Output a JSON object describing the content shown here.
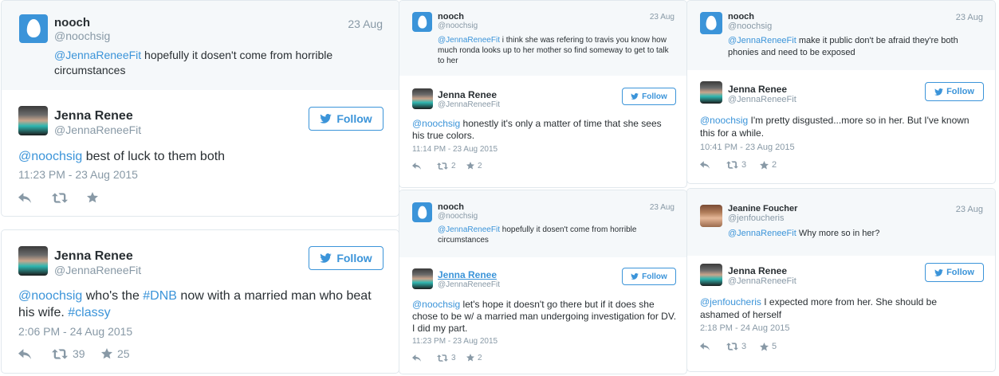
{
  "tweets": [
    {
      "ctx": {
        "name": "nooch",
        "handle": "@noochsig",
        "date": "23 Aug",
        "mention": "@JennaReneeFit",
        "text": " hopefully it dosen't come from horrible circumstances"
      },
      "reply": {
        "name": "Jenna Renee",
        "handle": "@JennaReneeFit",
        "follow": "Follow",
        "mention": "@noochsig",
        "text": " best of luck to them both",
        "time": "11:23 PM - 23 Aug 2015",
        "retweets": "",
        "likes": ""
      }
    },
    {
      "reply": {
        "name": "Jenna Renee",
        "handle": "@JennaReneeFit",
        "follow": "Follow",
        "mention": "@noochsig",
        "text_a": " who's the ",
        "hashtag1": "#DNB",
        "text_b": " now with a married man who beat his wife.  ",
        "hashtag2": "#classy",
        "time": "2:06 PM - 24 Aug 2015",
        "retweets": "39",
        "likes": "25"
      }
    },
    {
      "ctx": {
        "name": "nooch",
        "handle": "@noochsig",
        "date": "23 Aug",
        "mention": "@JennaReneeFit",
        "text": " i think she was refering to travis you know how much ronda looks up to her mother so find someway to get to talk to her"
      },
      "reply": {
        "name": "Jenna Renee",
        "handle": "@JennaReneeFit",
        "follow": "Follow",
        "mention": "@noochsig",
        "text": " honestly it's only a matter of time that she sees his true colors.",
        "time": "11:14 PM - 23 Aug 2015",
        "retweets": "2",
        "likes": "2"
      }
    },
    {
      "ctx": {
        "name": "nooch",
        "handle": "@noochsig",
        "date": "23 Aug",
        "mention": "@JennaReneeFit",
        "text": " hopefully it dosen't come from horrible circumstances"
      },
      "reply": {
        "name": "Jenna Renee",
        "handle": "@JennaReneeFit",
        "follow": "Follow",
        "mention": "@noochsig",
        "text": " let's hope it doesn't go there but if it does she chose to be w/ a married man undergoing investigation for DV. I did my part.",
        "time": "11:23 PM - 23 Aug 2015",
        "retweets": "3",
        "likes": "2"
      }
    },
    {
      "ctx": {
        "name": "nooch",
        "handle": "@noochsig",
        "date": "23 Aug",
        "mention": "@JennaReneeFit",
        "text": " make it public don't be afraid they're both phonies and need to be exposed"
      },
      "reply": {
        "name": "Jenna Renee",
        "handle": "@JennaReneeFit",
        "follow": "Follow",
        "mention": "@noochsig",
        "text": " I'm pretty disgusted...more so in her.  But I've known this for a while.",
        "time": "10:41 PM - 23 Aug 2015",
        "retweets": "3",
        "likes": "2"
      }
    },
    {
      "ctx": {
        "name": "Jeanine Foucher",
        "handle": "@jenfoucheris",
        "date": "23 Aug",
        "mention": "@JennaReneeFit",
        "text": " Why more so in her?"
      },
      "reply": {
        "name": "Jenna Renee",
        "handle": "@JennaReneeFit",
        "follow": "Follow",
        "mention": "@jenfoucheris",
        "text": " I expected more from her.  She should be ashamed of herself",
        "time": "2:18 PM - 24 Aug 2015",
        "retweets": "3",
        "likes": "5"
      }
    }
  ],
  "colors": {
    "accent": "#3b94d9",
    "text": "#292f33",
    "muted": "#8899a6",
    "context_bg": "#f5f8fa"
  },
  "icons": [
    "egg-avatar-icon",
    "bird-icon",
    "reply-icon",
    "retweet-icon",
    "star-icon"
  ]
}
